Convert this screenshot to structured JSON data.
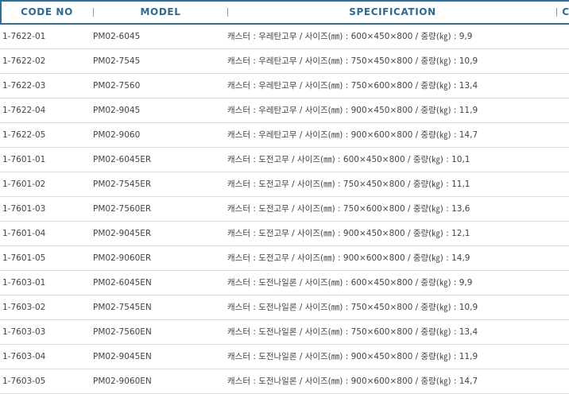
{
  "table": {
    "headers": {
      "code_no": "CODE NO",
      "model": "MODEL",
      "specification": "SPECIFICATION",
      "extra": "C"
    },
    "rows": [
      {
        "code": "1-7622-01",
        "model": "PM02-6045",
        "spec": "캐스터 : 우레탄고무 / 사이즈(㎜) : 600×450×800 / 중량(㎏) : 9,9"
      },
      {
        "code": "1-7622-02",
        "model": "PM02-7545",
        "spec": "캐스터 : 우레탄고무 / 사이즈(㎜) : 750×450×800 / 중량(㎏) : 10,9"
      },
      {
        "code": "1-7622-03",
        "model": "PM02-7560",
        "spec": "캐스터 : 우레탄고무 / 사이즈(㎜) : 750×600×800 / 중량(㎏) : 13,4"
      },
      {
        "code": "1-7622-04",
        "model": "PM02-9045",
        "spec": "캐스터 : 우레탄고무 / 사이즈(㎜) : 900×450×800 / 중량(㎏) : 11,9"
      },
      {
        "code": "1-7622-05",
        "model": "PM02-9060",
        "spec": "캐스터 : 우레탄고무 / 사이즈(㎜) : 900×600×800 / 중량(㎏) : 14,7"
      },
      {
        "code": "1-7601-01",
        "model": "PM02-6045ER",
        "spec": "캐스터 : 도전고무 / 사이즈(㎜) : 600×450×800 / 중량(㎏) : 10,1"
      },
      {
        "code": "1-7601-02",
        "model": "PM02-7545ER",
        "spec": "캐스터 : 도전고무 / 사이즈(㎜) : 750×450×800 / 중량(㎏) : 11,1"
      },
      {
        "code": "1-7601-03",
        "model": "PM02-7560ER",
        "spec": "캐스터 : 도전고무 / 사이즈(㎜) : 750×600×800 / 중량(㎏) : 13,6"
      },
      {
        "code": "1-7601-04",
        "model": "PM02-9045ER",
        "spec": "캐스터 : 도전고무 / 사이즈(㎜) : 900×450×800 / 중량(㎏) : 12,1"
      },
      {
        "code": "1-7601-05",
        "model": "PM02-9060ER",
        "spec": "캐스터 : 도전고무 / 사이즈(㎜) : 900×600×800 / 중량(㎏) : 14,9"
      },
      {
        "code": "1-7603-01",
        "model": "PM02-6045EN",
        "spec": "캐스터 : 도전나일론 / 사이즈(㎜) : 600×450×800 / 중량(㎏) : 9,9"
      },
      {
        "code": "1-7603-02",
        "model": "PM02-7545EN",
        "spec": "캐스터 : 도전나일론 / 사이즈(㎜) : 750×450×800 / 중량(㎏) : 10,9"
      },
      {
        "code": "1-7603-03",
        "model": "PM02-7560EN",
        "spec": "캐스터 : 도전나일론 / 사이즈(㎜) : 750×600×800 / 중량(㎏) : 13,4"
      },
      {
        "code": "1-7603-04",
        "model": "PM02-9045EN",
        "spec": "캐스터 : 도전나일론 / 사이즈(㎜) : 900×450×800 / 중량(㎏) : 11,9"
      },
      {
        "code": "1-7603-05",
        "model": "PM02-9060EN",
        "spec": "캐스터 : 도전나일론 / 사이즈(㎜) : 900×600×800 / 중량(㎏) : 14,7"
      }
    ]
  },
  "colors": {
    "header_border": "#2f6f9e",
    "header_text": "#2b6a96",
    "row_divider": "#dcdcdc",
    "cell_text": "#444444"
  }
}
